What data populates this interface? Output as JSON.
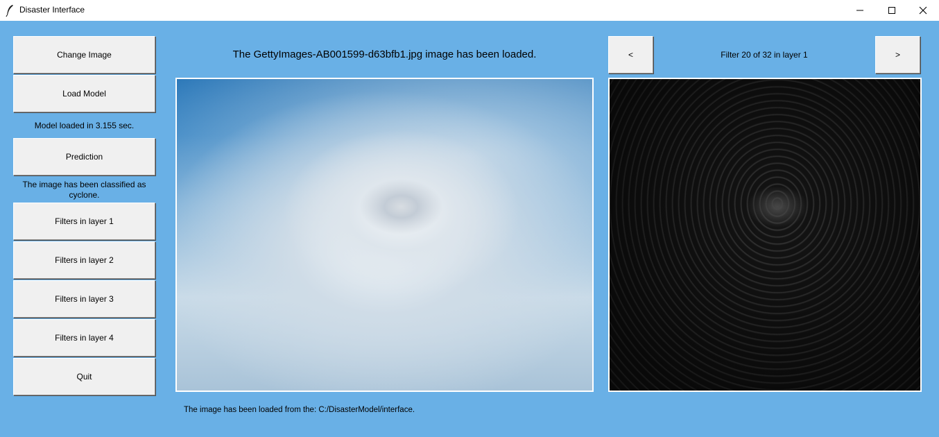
{
  "window": {
    "title": "Disaster Interface",
    "minimize_icon": "minimize-icon",
    "maximize_icon": "maximize-icon",
    "close_icon": "close-icon"
  },
  "sidebar": {
    "change_image": "Change Image",
    "load_model": "Load Model",
    "model_status": "Model loaded in 3.155 sec.",
    "prediction": "Prediction",
    "prediction_result": "The image has been classified as cyclone.",
    "filters_layer_1": "Filters in layer 1",
    "filters_layer_2": "Filters in layer 2",
    "filters_layer_3": "Filters in layer 3",
    "filters_layer_4": "Filters in layer 4",
    "quit": "Quit"
  },
  "main": {
    "load_status": "The GettyImages-AB001599-d63bfb1.jpg image has been loaded.",
    "path_status": "The image has been loaded from the: C:/DisasterModel/interface."
  },
  "filter_view": {
    "prev": "<",
    "next": ">",
    "label": "Filter 20 of 32 in layer 1"
  },
  "colors": {
    "background": "#69b0e6",
    "button": "#f0f0f0"
  }
}
